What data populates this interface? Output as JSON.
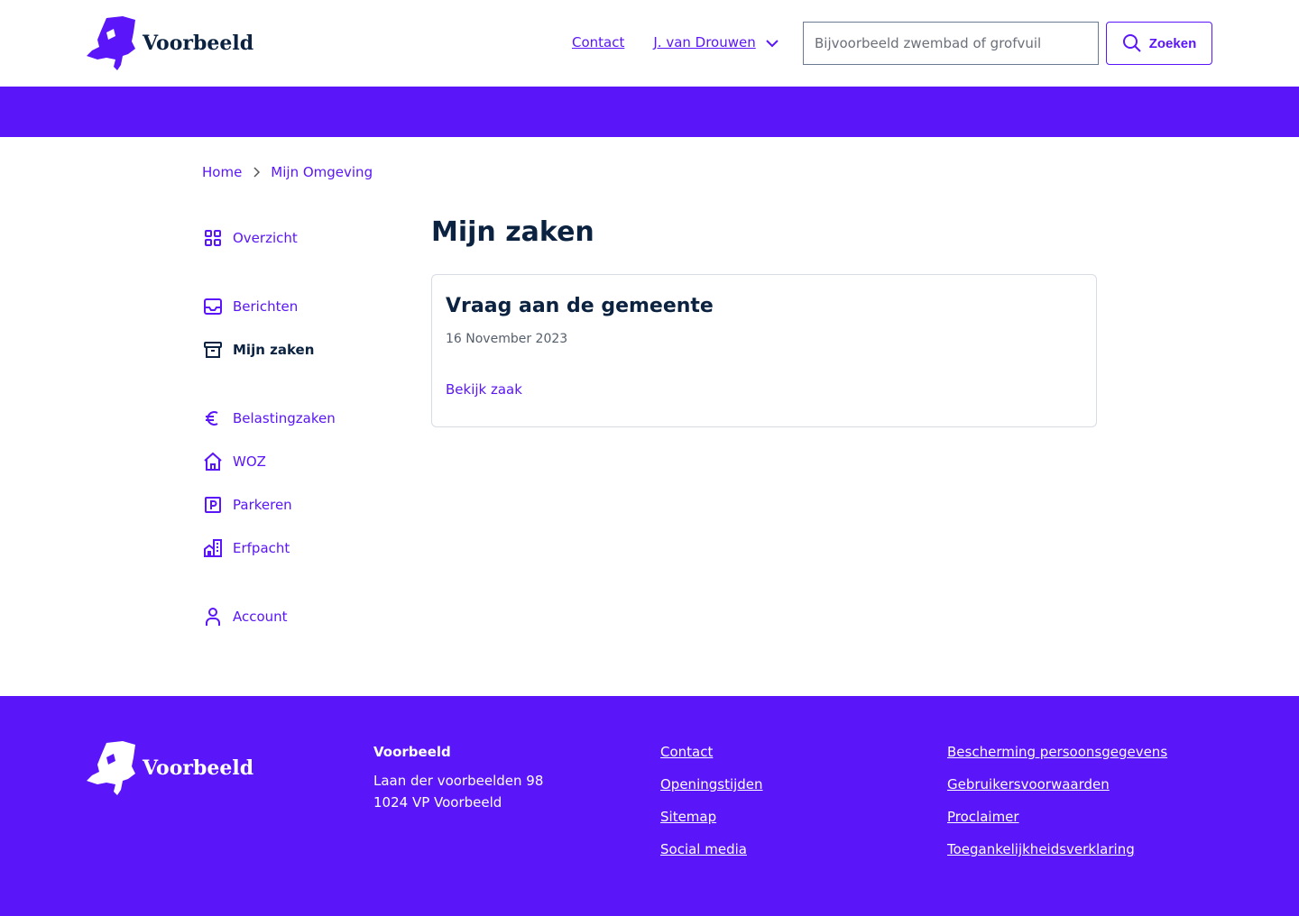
{
  "header": {
    "logo_text": "Voorbeeld",
    "nav": {
      "contact": "Contact",
      "user": "J. van Drouwen"
    },
    "search": {
      "placeholder": "Bijvoorbeeld zwembad of grofvuil",
      "button": "Zoeken"
    }
  },
  "breadcrumb": [
    "Home",
    "Mijn Omgeving"
  ],
  "sidebar": {
    "items": [
      {
        "label": "Overzicht",
        "icon": "grid-icon"
      },
      {
        "label": "Berichten",
        "icon": "inbox-icon"
      },
      {
        "label": "Mijn zaken",
        "icon": "archive-icon",
        "active": true
      },
      {
        "label": "Belastingzaken",
        "icon": "euro-icon"
      },
      {
        "label": "WOZ",
        "icon": "home-icon"
      },
      {
        "label": "Parkeren",
        "icon": "parking-icon"
      },
      {
        "label": "Erfpacht",
        "icon": "building-icon"
      },
      {
        "label": "Account",
        "icon": "user-icon"
      }
    ]
  },
  "main": {
    "title": "Mijn zaken",
    "card": {
      "title": "Vraag aan de gemeente",
      "date": "16 November 2023",
      "link": "Bekijk zaak"
    }
  },
  "footer": {
    "logo_text": "Voorbeeld",
    "org": "Voorbeeld",
    "address1": "Laan der voorbeelden 98",
    "address2": "1024 VP Voorbeeld",
    "links1": [
      "Contact",
      "Openingstijden",
      "Sitemap",
      "Social media"
    ],
    "links2": [
      "Bescherming persoonsgegevens",
      "Gebruikersvoorwaarden",
      "Proclaimer",
      "Toegankelijkheidsverklaring"
    ]
  },
  "colors": {
    "brand": "#5a16f9",
    "text": "#0b2240"
  }
}
